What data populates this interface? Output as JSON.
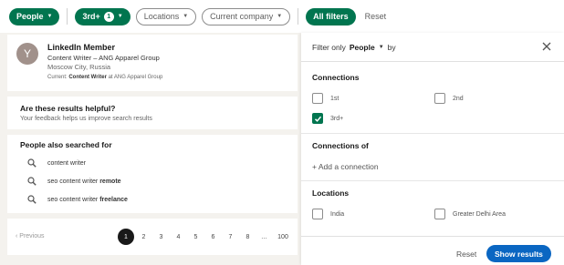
{
  "filterbar": {
    "people_label": "People",
    "connections_label": "3rd+",
    "connections_count": "1",
    "locations_label": "Locations",
    "company_label": "Current company",
    "all_filters_label": "All filters",
    "reset_label": "Reset"
  },
  "member": {
    "avatar_letter": "Y",
    "name": "LinkedIn Member",
    "headline": "Content Writer – ANG Apparel Group",
    "location": "Moscow City, Russia",
    "current_prefix": "Current: ",
    "current_role": "Content Writer",
    "current_suffix": " at ANG Apparel Group"
  },
  "helpful": {
    "title": "Are these results helpful?",
    "subtitle": "Your feedback helps us improve search results"
  },
  "people_also": {
    "title": "People also searched for",
    "items": [
      {
        "prefix": "content writer",
        "bold": ""
      },
      {
        "prefix": "seo content writer ",
        "bold": "remote"
      },
      {
        "prefix": "seo content writer ",
        "bold": "freelance"
      }
    ]
  },
  "pagination": {
    "previous_label": "Previous",
    "pages": [
      "1",
      "2",
      "3",
      "4",
      "5",
      "6",
      "7",
      "8",
      "…",
      "100"
    ],
    "current": "1"
  },
  "panel": {
    "filter_only_label": "Filter only",
    "filter_only_value": "People",
    "by_label": "by",
    "connections_title": "Connections",
    "connections_options": [
      {
        "label": "1st",
        "checked": false
      },
      {
        "label": "2nd",
        "checked": false
      },
      {
        "label": "3rd+",
        "checked": true
      }
    ],
    "connections_of_title": "Connections of",
    "add_connection_label": "+ Add a connection",
    "locations_title": "Locations",
    "locations_options": [
      {
        "label": "India",
        "checked": false
      },
      {
        "label": "Greater Delhi Area",
        "checked": false
      }
    ],
    "reset_label": "Reset",
    "show_results_label": "Show results"
  },
  "colors": {
    "accent_green": "#01754f",
    "primary_blue": "#0a66c2"
  }
}
